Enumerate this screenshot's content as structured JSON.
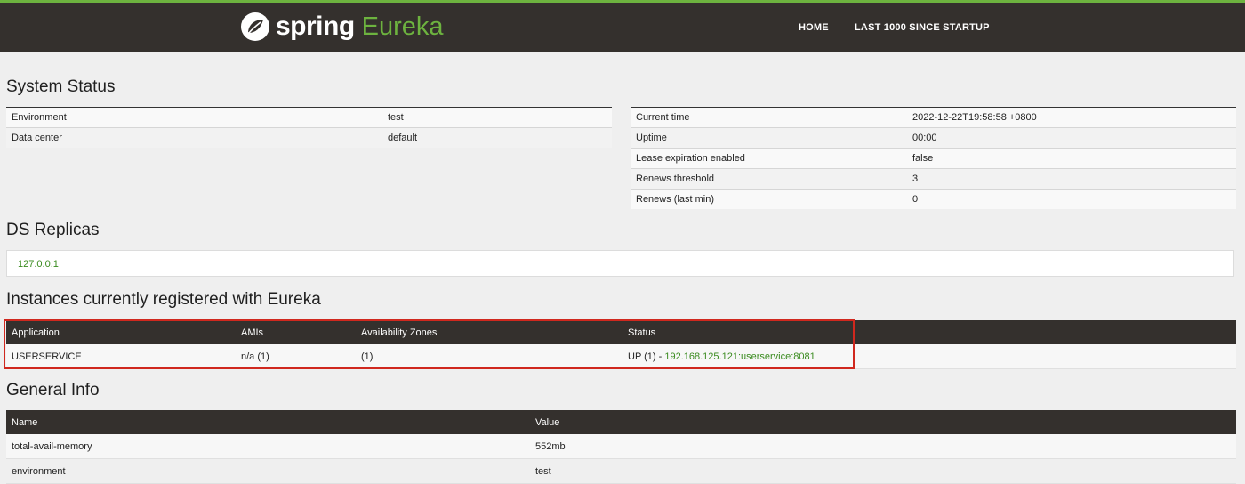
{
  "header": {
    "brand_spring": "spring",
    "brand_eureka": "Eureka",
    "nav": [
      {
        "label": "HOME"
      },
      {
        "label": "LAST 1000 SINCE STARTUP"
      }
    ],
    "colors": {
      "accent": "#6db33f",
      "navbar": "#34302d"
    }
  },
  "system_status": {
    "title": "System Status",
    "left_rows": [
      {
        "name": "Environment",
        "value": "test"
      },
      {
        "name": "Data center",
        "value": "default"
      }
    ],
    "right_rows": [
      {
        "name": "Current time",
        "value": "2022-12-22T19:58:58 +0800"
      },
      {
        "name": "Uptime",
        "value": "00:00"
      },
      {
        "name": "Lease expiration enabled",
        "value": "false"
      },
      {
        "name": "Renews threshold",
        "value": "3"
      },
      {
        "name": "Renews (last min)",
        "value": "0"
      }
    ]
  },
  "ds_replicas": {
    "title": "DS Replicas",
    "items": [
      "127.0.0.1"
    ]
  },
  "instances": {
    "title": "Instances currently registered with Eureka",
    "columns": [
      "Application",
      "AMIs",
      "Availability Zones",
      "Status"
    ],
    "rows": [
      {
        "application": "USERSERVICE",
        "amis": "n/a (1)",
        "zones": "(1)",
        "status_prefix": "UP (1) - ",
        "status_link": "192.168.125.121:userservice:8081"
      }
    ],
    "highlight_color": "#d0281e"
  },
  "general_info": {
    "title": "General Info",
    "columns": [
      "Name",
      "Value"
    ],
    "rows": [
      {
        "name": "total-avail-memory",
        "value": "552mb"
      },
      {
        "name": "environment",
        "value": "test"
      }
    ]
  }
}
